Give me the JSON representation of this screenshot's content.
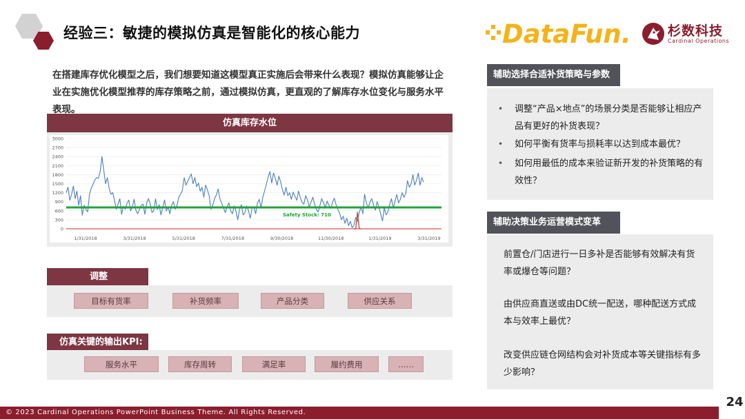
{
  "title": "经验三：敏捷的模拟仿真是智能化的核心能力",
  "logos": {
    "datafun": "DataFun.",
    "cardinal_cn": "杉数科技",
    "cardinal_en": "Cardinal Operations"
  },
  "intro": "在搭建库存优化模型之后，我们想要知道这模型真正实施后会带来什么表现？模拟仿真能够让企业在实施优化模型推荐的库存策略之前，通过模拟仿真，更直观的了解库存水位变化与服务水平表现。",
  "chart_panel_title": "仿真库存水位",
  "chart_data": {
    "type": "line",
    "x_tick_labels": [
      "1/31/2018",
      "3/31/2018",
      "5/31/2018",
      "7/31/2018",
      "9/30/2018",
      "11/30/2018",
      "1/31/2019",
      "3/31/2019"
    ],
    "y_tick_labels": [
      "0",
      "300",
      "600",
      "900",
      "1200",
      "1500",
      "1800",
      "2100",
      "2400",
      "2700",
      "3000"
    ],
    "ylim": [
      0,
      3000
    ],
    "series": [
      {
        "color": "#4a7fc1",
        "x": [
          0,
          2,
          4,
          6,
          8,
          10,
          12,
          14,
          16,
          18,
          20,
          22,
          24,
          26,
          28,
          30,
          32,
          34,
          36,
          38,
          40,
          42,
          44,
          46,
          48,
          50,
          52,
          54,
          56,
          58,
          60,
          62,
          64,
          66,
          68,
          70,
          72,
          74,
          76,
          78,
          80,
          82,
          84,
          86,
          88,
          90,
          92,
          94,
          96,
          98,
          100
        ],
        "values": [
          1200,
          1380,
          950,
          1150,
          1420,
          1000,
          1250,
          780,
          1100,
          450,
          780,
          650,
          560,
          1150,
          1350,
          1480,
          1620,
          1700,
          1680,
          1900,
          2400,
          1950,
          1500,
          1700,
          1350,
          1150,
          1200,
          950,
          650,
          820,
          1000,
          480,
          750,
          650,
          850,
          950,
          600,
          720,
          980,
          620,
          500,
          650,
          780,
          820,
          480,
          860,
          1000,
          820,
          540,
          600,
          1000
        ]
      },
      {
        "color": "#4a7fc1",
        "x": [
          100,
          102,
          104,
          106,
          108,
          110,
          112,
          114,
          116,
          118,
          120,
          122,
          124,
          126,
          128,
          130,
          132,
          134,
          136,
          138,
          140,
          142,
          144,
          146,
          148,
          150,
          152,
          154,
          156,
          158,
          160,
          162,
          164,
          166,
          168,
          170,
          172,
          174,
          176,
          178,
          180,
          182,
          184,
          186,
          188,
          190,
          192,
          194,
          196,
          198,
          200
        ],
        "values": [
          1000,
          640,
          800,
          460,
          700,
          960,
          590,
          720,
          500,
          780,
          900,
          650,
          780,
          1050,
          1150,
          1280,
          1700,
          1450,
          1580,
          1700,
          1820,
          1500,
          1700,
          1400,
          1520,
          1250,
          1380,
          1050,
          1450,
          1300,
          1100,
          650,
          780,
          1000,
          1120,
          1320,
          1000,
          840,
          700,
          540,
          720,
          860,
          600,
          500,
          760,
          580,
          300,
          640,
          800,
          460,
          540
        ]
      },
      {
        "color": "#4a7fc1",
        "x": [
          200,
          202,
          204,
          206,
          208,
          210,
          212,
          214,
          216,
          218,
          220,
          222,
          224,
          226,
          228,
          230,
          232,
          234,
          236,
          238,
          240,
          242,
          244,
          246,
          248,
          250,
          252,
          254,
          256,
          258,
          260,
          262,
          264,
          266,
          268,
          270,
          272,
          274,
          276,
          278,
          280,
          282,
          284,
          286,
          288,
          290,
          292,
          294,
          296,
          298,
          300
        ],
        "values": [
          540,
          760,
          600,
          350,
          680,
          720,
          500,
          860,
          980,
          700,
          1050,
          1250,
          1480,
          1720,
          1900,
          1520,
          1850,
          1680,
          1450,
          1750,
          1550,
          1300,
          1120,
          1380,
          1100,
          1200,
          980,
          1220,
          1080,
          950,
          1250,
          1030,
          880,
          820,
          1100,
          960,
          720,
          880,
          1050,
          820,
          640,
          560,
          780,
          1000,
          860,
          700,
          920,
          780,
          680,
          880,
          1020
        ]
      },
      {
        "color": "#4a7fc1",
        "x": [
          300,
          302,
          304,
          306,
          308,
          310,
          312,
          314,
          316,
          318,
          320,
          322,
          324,
          326,
          328,
          330,
          332,
          334,
          336,
          338,
          340,
          342,
          344,
          346,
          348,
          350,
          352,
          354,
          356,
          358,
          360,
          362,
          364,
          366,
          368,
          370,
          372,
          374,
          376,
          378,
          380,
          382,
          384,
          386,
          388,
          390,
          392,
          394,
          396,
          398,
          400
        ],
        "values": [
          1020,
          800,
          640,
          520,
          300,
          420,
          180,
          350,
          100,
          250,
          40,
          120,
          380,
          250,
          550,
          720,
          500,
          1150,
          850,
          700,
          900,
          1000,
          780,
          620,
          900,
          720,
          500,
          260,
          700,
          460,
          560,
          820,
          1000,
          680,
          920,
          1140,
          860,
          980,
          1200,
          1050,
          1180,
          1600,
          1380,
          1500,
          1800,
          1450,
          1600,
          1850,
          1450,
          1700,
          1550
        ]
      },
      {
        "color": "#c0504d",
        "x": [
          322,
          324,
          326,
          328,
          330
        ],
        "values": [
          0,
          0,
          550,
          0,
          0
        ]
      }
    ],
    "safety_stock": {
      "value": 710,
      "label": "Safety Stock: 710",
      "color": "#1fa33a"
    },
    "zero_line_color": "#d9534f"
  },
  "adjust_section": {
    "title": "调整",
    "items": [
      "目标有货率",
      "补货频率",
      "产品分类",
      "供应关系"
    ]
  },
  "kpi_section": {
    "title": "仿真关键的输出KPI:",
    "items": [
      "服务水平",
      "库存周转",
      "满足率",
      "履约费用",
      "……"
    ]
  },
  "right_top": {
    "tag": "辅助选择合适补货策略与参数",
    "bullets": [
      "调整“产品×地点”的场景分类是否能够让相应产品有更好的补货表现？",
      "如何平衡有货率与损耗率以达到成本最优？",
      "如何用最低的成本来验证新开发的补货策略的有效性？"
    ]
  },
  "right_bottom": {
    "tag": "辅助决策业务运营模式变革",
    "paragraphs": [
      "前置仓/门店进行一日多补是否能够有效解决有货率或爆仓等问题？",
      "由供应商直送或由DC统一配送，哪种配送方式成本与效率上最优？",
      "改变供应链仓网结构会对补货成本等关键指标有多少影响？"
    ]
  },
  "footer": "© 2023 Cardinal Operations PowerPoint Business Theme. All Rights Reserved.",
  "page_number": "24",
  "colors": {
    "brand_red": "#8b1d2c",
    "section_bar": "#7d3642",
    "chip": "#d8b2b4",
    "tag_dark": "#52535a",
    "panel_bg": "#ececec",
    "logo_yellow": "#f5b31a"
  }
}
